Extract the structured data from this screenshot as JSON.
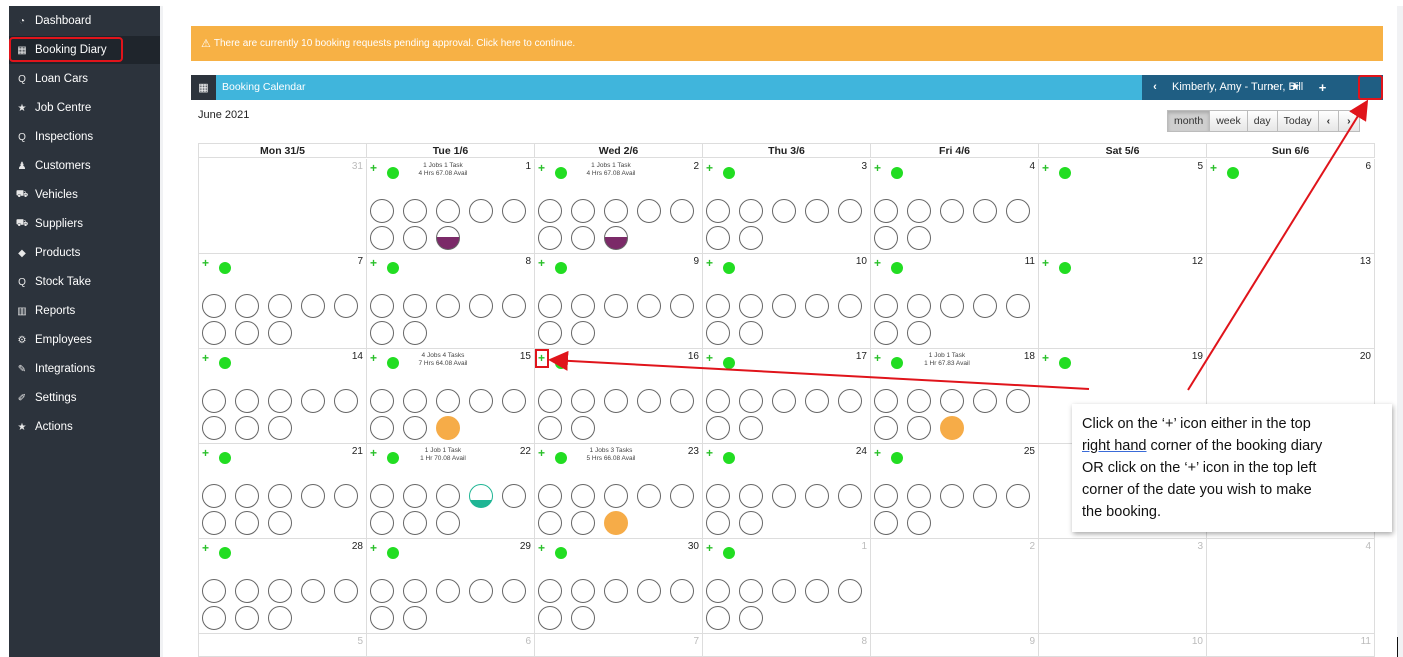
{
  "sidebar": {
    "items": [
      {
        "label": "Dashboard",
        "icon": "dashboard-icon",
        "glyph": "◔"
      },
      {
        "label": "Booking Diary",
        "icon": "calendar-icon",
        "glyph": "▦"
      },
      {
        "label": "Loan Cars",
        "icon": "search-icon",
        "glyph": "Q"
      },
      {
        "label": "Job Centre",
        "icon": "star-icon",
        "glyph": "★"
      },
      {
        "label": "Inspections",
        "icon": "search-icon",
        "glyph": "Q"
      },
      {
        "label": "Customers",
        "icon": "users-icon",
        "glyph": "♟"
      },
      {
        "label": "Vehicles",
        "icon": "car-icon",
        "glyph": "⛟"
      },
      {
        "label": "Suppliers",
        "icon": "truck-icon",
        "glyph": "⛟"
      },
      {
        "label": "Products",
        "icon": "tags-icon",
        "glyph": "◆"
      },
      {
        "label": "Stock Take",
        "icon": "search-icon",
        "glyph": "Q"
      },
      {
        "label": "Reports",
        "icon": "bar-chart-icon",
        "glyph": "▥"
      },
      {
        "label": "Employees",
        "icon": "cogs-icon",
        "glyph": "⚙"
      },
      {
        "label": "Integrations",
        "icon": "plug-icon",
        "glyph": "✎"
      },
      {
        "label": "Settings",
        "icon": "wrench-icon",
        "glyph": "✐"
      },
      {
        "label": "Actions",
        "icon": "star-icon",
        "glyph": "★"
      }
    ],
    "active_index": 1
  },
  "alert": {
    "icon": "warning-icon",
    "text": "There are currently 10 booking requests pending approval. Click here to continue."
  },
  "calendar_header": {
    "title": "Booking Calendar",
    "staff": "Kimberly, Amy - Turner, Bill",
    "prev_glyph": "‹",
    "next_glyph": "›",
    "star_glyph": "★",
    "add_glyph": "+"
  },
  "month_title": "June 2021",
  "views": {
    "month": "month",
    "week": "week",
    "day": "day",
    "today": "Today",
    "prev": "‹",
    "next": "›"
  },
  "days": [
    "Mon 31/5",
    "Tue 1/6",
    "Wed 2/6",
    "Thu 3/6",
    "Fri 4/6",
    "Sat 5/6",
    "Sun 6/6"
  ],
  "weeks": [
    {
      "cells": [
        {
          "num": "31",
          "other": true,
          "plus": false,
          "slots": 0
        },
        {
          "num": "1",
          "plus": true,
          "info": "1 Jobs 1 Task\n4 Hrs 67.08 Avail",
          "slots": 8,
          "fill": [
            {
              "i": 7,
              "t": "purple"
            }
          ]
        },
        {
          "num": "2",
          "plus": true,
          "info": "1 Jobs 1 Task\n4 Hrs 67.08 Avail",
          "slots": 8,
          "fill": [
            {
              "i": 7,
              "t": "purple"
            }
          ]
        },
        {
          "num": "3",
          "plus": true,
          "slots": 7
        },
        {
          "num": "4",
          "plus": true,
          "slots": 7
        },
        {
          "num": "5",
          "plus": true,
          "slots": 0
        },
        {
          "num": "6",
          "plus": true,
          "slots": 0
        }
      ]
    },
    {
      "cells": [
        {
          "num": "7",
          "plus": true,
          "slots": 8
        },
        {
          "num": "8",
          "plus": true,
          "slots": 7
        },
        {
          "num": "9",
          "plus": true,
          "slots": 7
        },
        {
          "num": "10",
          "plus": true,
          "slots": 7
        },
        {
          "num": "11",
          "plus": true,
          "slots": 7
        },
        {
          "num": "12",
          "plus": true,
          "slots": 0
        },
        {
          "num": "13",
          "plus": false,
          "slots": 0
        }
      ]
    },
    {
      "cells": [
        {
          "num": "14",
          "plus": true,
          "slots": 8
        },
        {
          "num": "15",
          "plus": true,
          "info": "4 Jobs 4 Tasks\n7 Hrs 64.08 Avail",
          "slots": 8,
          "fill": [
            {
              "i": 7,
              "t": "orange"
            }
          ]
        },
        {
          "num": "16",
          "plus": true,
          "slots": 7
        },
        {
          "num": "17",
          "plus": true,
          "slots": 7
        },
        {
          "num": "18",
          "plus": true,
          "info": "1 Job 1 Task\n1 Hr 67.83 Avail",
          "slots": 8,
          "fill": [
            {
              "i": 7,
              "t": "orange"
            }
          ]
        },
        {
          "num": "19",
          "plus": true,
          "slots": 0
        },
        {
          "num": "20",
          "plus": false,
          "slots": 0
        }
      ]
    },
    {
      "cells": [
        {
          "num": "21",
          "plus": true,
          "slots": 8
        },
        {
          "num": "22",
          "plus": true,
          "info": "1 Job 1 Task\n1 Hr 70.08 Avail",
          "slots": 8,
          "fill": [
            {
              "i": 3,
              "t": "teal"
            }
          ]
        },
        {
          "num": "23",
          "plus": true,
          "info": "1 Jobs 3 Tasks\n5 Hrs 66.08 Avail",
          "slots": 8,
          "fill": [
            {
              "i": 7,
              "t": "orange"
            }
          ]
        },
        {
          "num": "24",
          "plus": true,
          "slots": 7
        },
        {
          "num": "25",
          "plus": true,
          "slots": 7
        },
        {
          "num": "",
          "plus": false,
          "slots": 0
        },
        {
          "num": "",
          "plus": false,
          "slots": 0
        }
      ]
    },
    {
      "cells": [
        {
          "num": "28",
          "plus": true,
          "slots": 8
        },
        {
          "num": "29",
          "plus": true,
          "slots": 7
        },
        {
          "num": "30",
          "plus": true,
          "slots": 7
        },
        {
          "num": "1",
          "other": true,
          "plus": true,
          "slots": 7
        },
        {
          "num": "2",
          "other": true,
          "plus": false,
          "slots": 0
        },
        {
          "num": "3",
          "other": true,
          "plus": false,
          "slots": 0
        },
        {
          "num": "4",
          "other": true,
          "plus": false,
          "slots": 0
        }
      ]
    },
    {
      "cells": [
        {
          "num": "5",
          "other": true,
          "plus": false,
          "slots": 0
        },
        {
          "num": "6",
          "other": true,
          "plus": false,
          "slots": 0
        },
        {
          "num": "7",
          "other": true,
          "plus": false,
          "slots": 0
        },
        {
          "num": "8",
          "other": true,
          "plus": false,
          "slots": 0
        },
        {
          "num": "9",
          "other": true,
          "plus": false,
          "slots": 0
        },
        {
          "num": "10",
          "other": true,
          "plus": false,
          "slots": 0
        },
        {
          "num": "11",
          "other": true,
          "plus": false,
          "slots": 0
        }
      ]
    }
  ],
  "note": {
    "line1": "Click on the ‘+’ icon either in the top",
    "underlined": "right hand",
    "line2_rest": " corner of the booking diary",
    "line3": "OR click on the ‘+’ icon in the top left",
    "line4": "corner of the date you wish to make",
    "line5": "the booking."
  },
  "colors": {
    "accent": "#40b5dc",
    "alert": "#f7b145",
    "sidebar": "#2c333c",
    "annotation": "#e0141b",
    "available": "#22dd22"
  }
}
